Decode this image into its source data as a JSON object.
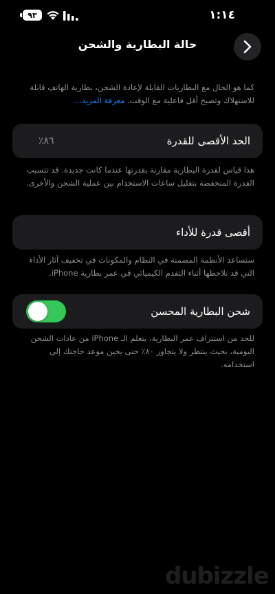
{
  "status_bar": {
    "time": "١:١٤",
    "battery_level": "٩٣"
  },
  "nav": {
    "title": "حالة البطارية والشحن"
  },
  "intro": {
    "text": "كما هو الحال مع البطاريات القابلة لإعادة الشحن، بطارية الهاتف قابلة للاستهلاك وتصبح أقل فاعلية مع الوقت.",
    "link": "معرفة المزيد..."
  },
  "max_capacity": {
    "label": "الحد الأقصى للقدرة",
    "value": "٨٦٪",
    "description": "هذا قياس لقدرة البطارية مقارنة بقدرتها عندما كانت جديدة. قد تتسبب القدرة المنخفضة بتقليل ساعات الاستخدام بين عملية الشحن والأخرى."
  },
  "peak_performance": {
    "label": "أقصى قدرة للأداء",
    "description": "ستساعد الأنظمة المضمنة في النظام والمكونات في تخفيف آثار الأداء التي قد تلاحظها أثناء التقدم الكيميائي في عمر بطارية iPhone."
  },
  "optimized_charging": {
    "label": "شحن البطارية المحسن",
    "enabled": true,
    "description": "للحد من استنزاف عمر البطارية، يتعلم الـ iPhone من عادات الشحن اليومية، بحيث ينتظر ولا يتجاوز ٨٠٪ حتى يحين موعد حاجتك إلى استخدامه."
  },
  "watermark": {
    "text": "dubizzle"
  },
  "colors": {
    "background": "#000000",
    "card": "#1c1c1e",
    "toggle_on": "#34c759",
    "link": "#0a84ff",
    "secondary_text": "#8e8e93"
  },
  "icons": {
    "back": "chevron-right-icon",
    "wifi": "wifi-icon",
    "signal": "signal-icon",
    "battery": "battery-icon"
  }
}
